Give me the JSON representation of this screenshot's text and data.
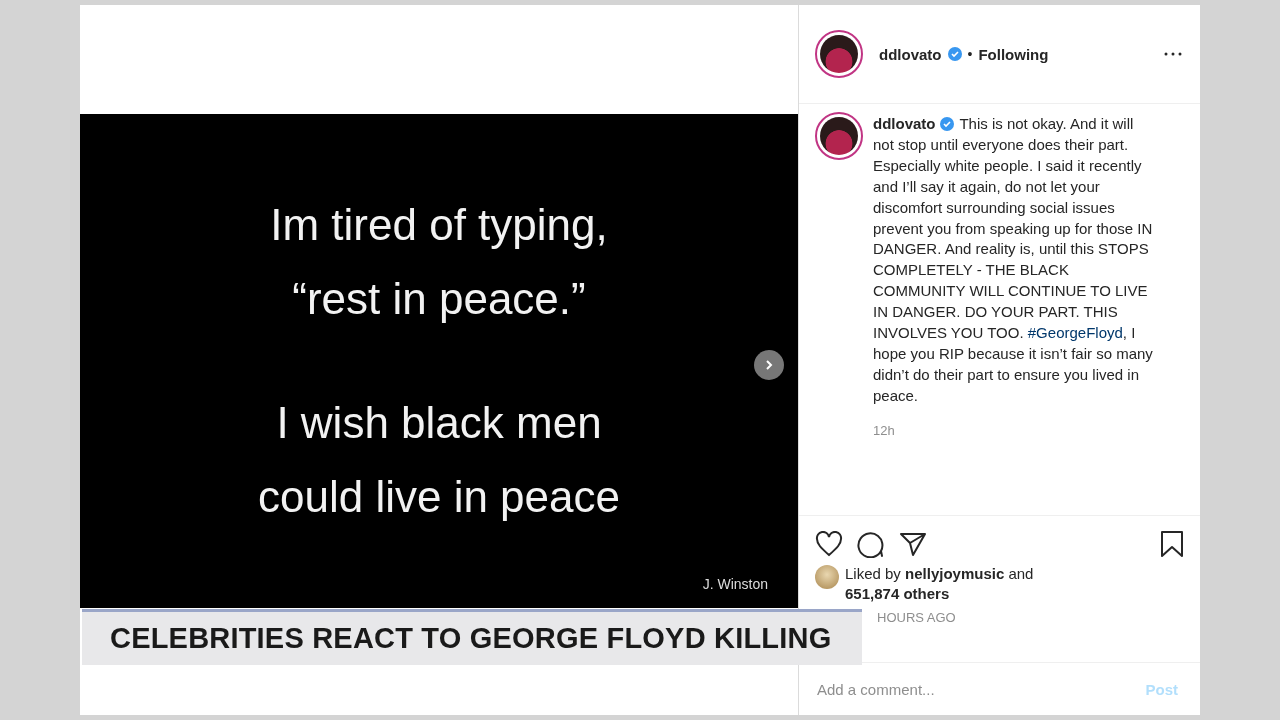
{
  "post_image": {
    "blocks": [
      [
        "Im tired of typing,",
        "“rest in peace.”"
      ],
      [
        "I wish black men",
        "could live in peace"
      ]
    ],
    "credit": "J. Winston",
    "has_next": true
  },
  "header": {
    "username": "ddlovato",
    "verified": true,
    "separator": "•",
    "follow_status": "Following"
  },
  "caption": {
    "username": "ddlovato",
    "verified": true,
    "text_before": "This is not okay. And it will not stop until everyone does their part. Especially white people. I said it recently and I’ll say it again, do not let your discomfort surrounding social issues prevent you from speaking up for those IN DANGER. And reality is, until this STOPS COMPLETELY - THE BLACK COMMUNITY WILL CONTINUE TO LIVE IN DANGER. DO YOUR PART. THIS INVOLVES YOU TOO.",
    "hashtag": "#GeorgeFloyd",
    "text_after": ", I hope you RIP because it isn’t fair so many didn’t do their part to ensure you lived in peace.",
    "time": "12h"
  },
  "likes": {
    "text": "Liked by **nellyjoymusic** and **651,874 others**"
  },
  "post_time": "HOURS AGO",
  "comment": {
    "placeholder": "Add a comment...",
    "post_button": "Post",
    "post_enabled": false
  },
  "banner": {
    "headline": "CELEBRITIES REACT TO GEORGE FLOYD KILLING"
  }
}
